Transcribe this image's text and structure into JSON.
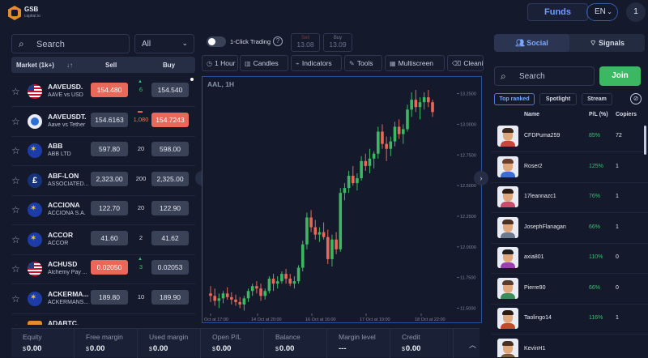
{
  "header": {
    "logo_text": "GSB",
    "logo_sub": "capital.io",
    "funds_label": "Funds",
    "lang": "EN",
    "user_badge": "1"
  },
  "market": {
    "search_placeholder": "Search",
    "filter_value": "All",
    "col_market": "Market (1k+)",
    "col_sort": "↓↑",
    "col_sell": "Sell",
    "col_buy": "Buy",
    "rows": [
      {
        "symbol": "AAVEUSD.",
        "desc": "AAVE vs USD",
        "sell": "154.480",
        "buy": "154.540",
        "spread": "6",
        "flag": "us",
        "sell_red": true,
        "buy_red": false,
        "dir": "up"
      },
      {
        "symbol": "AAVEUSDT.",
        "desc": "Aave vs Tether",
        "sell": "154.6163",
        "buy": "154.7243",
        "spread": "1,080",
        "flag": "tether",
        "sell_red": false,
        "buy_red": true,
        "dir": "down"
      },
      {
        "symbol": "ABB",
        "desc": "ABB LTD",
        "sell": "597.80",
        "buy": "598.00",
        "spread": "20",
        "flag": "eu",
        "sell_red": false,
        "buy_red": false,
        "dir": ""
      },
      {
        "symbol": "ABF-LON",
        "desc": "ASSOCIATED...",
        "sell": "2,323.00",
        "buy": "2,325.00",
        "spread": "200",
        "flag": "gb",
        "sell_red": false,
        "buy_red": false,
        "dir": ""
      },
      {
        "symbol": "ACCIONA",
        "desc": "ACCIONA S.A.",
        "sell": "122.70",
        "buy": "122.90",
        "spread": "20",
        "flag": "eu",
        "sell_red": false,
        "buy_red": false,
        "dir": ""
      },
      {
        "symbol": "ACCOR",
        "desc": "ACCOR",
        "sell": "41.60",
        "buy": "41.62",
        "spread": "2",
        "flag": "eu",
        "sell_red": false,
        "buy_red": false,
        "dir": ""
      },
      {
        "symbol": "ACHUSD",
        "desc": "Alchemy Pay ...",
        "sell": "0.02050",
        "buy": "0.02053",
        "spread": "3",
        "flag": "us",
        "sell_red": true,
        "buy_red": false,
        "dir": "up"
      },
      {
        "symbol": "ACKERMA...",
        "desc": "ACKERMANS...",
        "sell": "189.80",
        "buy": "189.90",
        "spread": "10",
        "flag": "eu",
        "sell_red": false,
        "buy_red": false,
        "dir": ""
      },
      {
        "symbol": "ADABTC.",
        "desc": "",
        "sell": "",
        "buy": "",
        "spread": "",
        "flag": "btc",
        "sell_red": false,
        "buy_red": false,
        "dir": ""
      }
    ]
  },
  "trading": {
    "one_click": "1-Click Trading",
    "help": "?",
    "sell_label": "Sell",
    "sell_value": "13.08",
    "buy_label": "Buy",
    "buy_value": "13.09",
    "toolbar": [
      {
        "icon": "◷",
        "label": "1 Hour"
      },
      {
        "icon": "▥",
        "label": "Candles"
      },
      {
        "icon": "⌁",
        "label": "Indicators"
      },
      {
        "icon": "✎",
        "label": "Tools"
      },
      {
        "icon": "▦",
        "label": "Multiscreen"
      },
      {
        "icon": "⌫",
        "label": "Cleaning"
      }
    ]
  },
  "chart_data": {
    "type": "candlestick",
    "title": "AAL, 1H",
    "y_ticks": [
      "13.2500",
      "13.0000",
      "12.7500",
      "12.5000",
      "12.2500",
      "12.0000",
      "11.7500",
      "11.5000"
    ],
    "ylim": [
      11.47,
      13.32
    ],
    "x_ticks": [
      "Oct at 17:00",
      "14 Oct at 20:00",
      "16 Oct at 16:00",
      "17 Oct at 19:00",
      "18 Oct at 22:00"
    ],
    "candles": [
      [
        11.62,
        11.68,
        11.55,
        11.6
      ],
      [
        11.6,
        11.66,
        11.52,
        11.56
      ],
      [
        11.56,
        11.62,
        11.5,
        11.58
      ],
      [
        11.58,
        11.64,
        11.54,
        11.62
      ],
      [
        11.62,
        11.67,
        11.57,
        11.59
      ],
      [
        11.59,
        11.63,
        11.53,
        11.57
      ],
      [
        11.57,
        11.61,
        11.52,
        11.55
      ],
      [
        11.55,
        11.59,
        11.5,
        11.53
      ],
      [
        11.53,
        11.6,
        11.48,
        11.58
      ],
      [
        11.58,
        11.66,
        11.55,
        11.64
      ],
      [
        11.64,
        11.7,
        11.6,
        11.68
      ],
      [
        11.68,
        11.72,
        11.62,
        11.66
      ],
      [
        11.66,
        11.7,
        11.56,
        11.6
      ],
      [
        11.6,
        11.66,
        11.57,
        11.64
      ],
      [
        11.64,
        11.76,
        11.62,
        11.74
      ],
      [
        11.74,
        11.78,
        11.64,
        11.7
      ],
      [
        11.7,
        11.76,
        11.66,
        11.72
      ],
      [
        11.72,
        11.8,
        11.7,
        11.78
      ],
      [
        11.78,
        11.82,
        11.7,
        11.74
      ],
      [
        11.74,
        11.78,
        11.68,
        11.7
      ],
      [
        11.7,
        11.76,
        11.66,
        11.72
      ],
      [
        11.72,
        11.85,
        11.7,
        11.83
      ],
      [
        11.83,
        12.05,
        11.8,
        12.02
      ],
      [
        12.02,
        12.28,
        11.98,
        12.24
      ],
      [
        12.24,
        12.3,
        12.12,
        12.16
      ],
      [
        12.16,
        12.22,
        12.06,
        12.1
      ],
      [
        12.1,
        12.16,
        12.04,
        12.12
      ],
      [
        12.12,
        12.2,
        12.06,
        12.08
      ],
      [
        12.08,
        12.14,
        11.86,
        11.9
      ],
      [
        11.9,
        12.1,
        11.84,
        12.06
      ],
      [
        12.06,
        12.12,
        11.94,
        11.98
      ],
      [
        11.98,
        12.48,
        11.96,
        12.44
      ],
      [
        12.44,
        12.52,
        12.38,
        12.48
      ],
      [
        12.48,
        12.62,
        12.44,
        12.58
      ],
      [
        12.58,
        12.66,
        12.5,
        12.52
      ],
      [
        12.52,
        12.6,
        12.46,
        12.56
      ],
      [
        12.56,
        12.74,
        12.54,
        12.7
      ],
      [
        12.7,
        12.76,
        12.62,
        12.66
      ],
      [
        12.66,
        12.8,
        12.6,
        12.72
      ],
      [
        12.72,
        12.78,
        12.64,
        12.76
      ],
      [
        12.76,
        12.98,
        12.72,
        12.94
      ],
      [
        12.94,
        13.0,
        12.8,
        12.84
      ],
      [
        12.84,
        12.9,
        12.7,
        12.8
      ],
      [
        12.8,
        12.9,
        12.74,
        12.86
      ],
      [
        12.86,
        13.02,
        12.82,
        12.98
      ],
      [
        12.98,
        13.04,
        12.88,
        12.92
      ],
      [
        12.92,
        13.0,
        12.84,
        12.96
      ],
      [
        12.96,
        13.16,
        12.94,
        13.12
      ],
      [
        13.12,
        13.26,
        13.06,
        13.2
      ],
      [
        13.2,
        13.28,
        13.1,
        13.14
      ],
      [
        13.14,
        13.22,
        13.04,
        13.18
      ],
      [
        13.18,
        13.26,
        13.12,
        13.22
      ],
      [
        13.22,
        13.28,
        13.14,
        13.18
      ],
      [
        13.18,
        13.2,
        13.06,
        13.1
      ]
    ],
    "up_color": "#3cb862",
    "down_color": "#e8685a"
  },
  "social": {
    "tab_social": "Social",
    "tab_signals": "Signals",
    "search_placeholder": "Search",
    "join_label": "Join",
    "chips": [
      "Top ranked",
      "Spotlight",
      "Stream"
    ],
    "col_name": "Name",
    "col_pl": "P/L (%)",
    "col_copiers": "Copiers",
    "traders": [
      {
        "name": "CFDPuma259",
        "pl": "85%",
        "copiers": "72"
      },
      {
        "name": "Roser2",
        "pl": "125%",
        "copiers": "1"
      },
      {
        "name": "17leannazc1",
        "pl": "76%",
        "copiers": "1"
      },
      {
        "name": "JosephFlanagan",
        "pl": "66%",
        "copiers": "1"
      },
      {
        "name": "axia801",
        "pl": "110%",
        "copiers": "0"
      },
      {
        "name": "Pierre90",
        "pl": "66%",
        "copiers": "0"
      },
      {
        "name": "Taolingo14",
        "pl": "116%",
        "copiers": "1"
      },
      {
        "name": "KevinH1",
        "pl": "",
        "copiers": ""
      }
    ]
  },
  "account": [
    {
      "label": "Equity",
      "value": "0.00"
    },
    {
      "label": "Free margin",
      "value": "0.00"
    },
    {
      "label": "Used margin",
      "value": "0.00"
    },
    {
      "label": "Open P/L",
      "value": "0.00"
    },
    {
      "label": "Balance",
      "value": "0.00"
    },
    {
      "label": "Margin level",
      "value": "---"
    },
    {
      "label": "Credit",
      "value": "0.00"
    }
  ],
  "currency_symbol": "$"
}
